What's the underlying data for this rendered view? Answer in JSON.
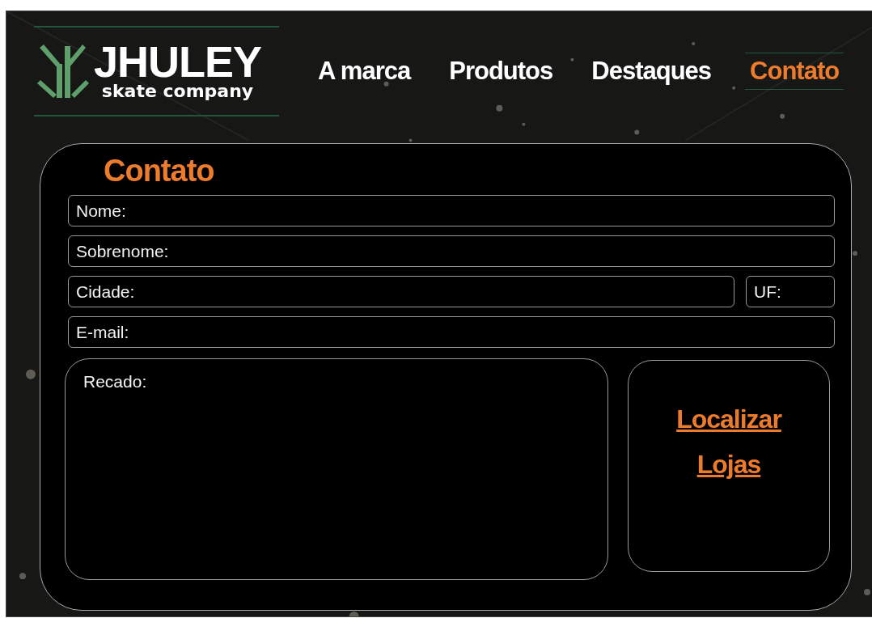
{
  "logo": {
    "name": "JHULEY",
    "tagline": "skate company"
  },
  "nav": [
    {
      "label": "A marca",
      "selected": false
    },
    {
      "label": "Produtos",
      "selected": false
    },
    {
      "label": "Destaques",
      "selected": false
    },
    {
      "label": "Contato",
      "selected": true
    }
  ],
  "form": {
    "title": "Contato",
    "fields": [
      {
        "kind": "full",
        "placeholder": "Nome:"
      },
      {
        "kind": "full",
        "placeholder": "Sobrenome:"
      },
      {
        "kind": "city",
        "placeholder": "Cidade:"
      },
      {
        "kind": "state",
        "placeholder": "UF:"
      },
      {
        "kind": "full",
        "placeholder": "E-mail:"
      }
    ],
    "message": {
      "placeholder": "Recado:"
    },
    "store_link": "Localizar Lojas"
  }
}
